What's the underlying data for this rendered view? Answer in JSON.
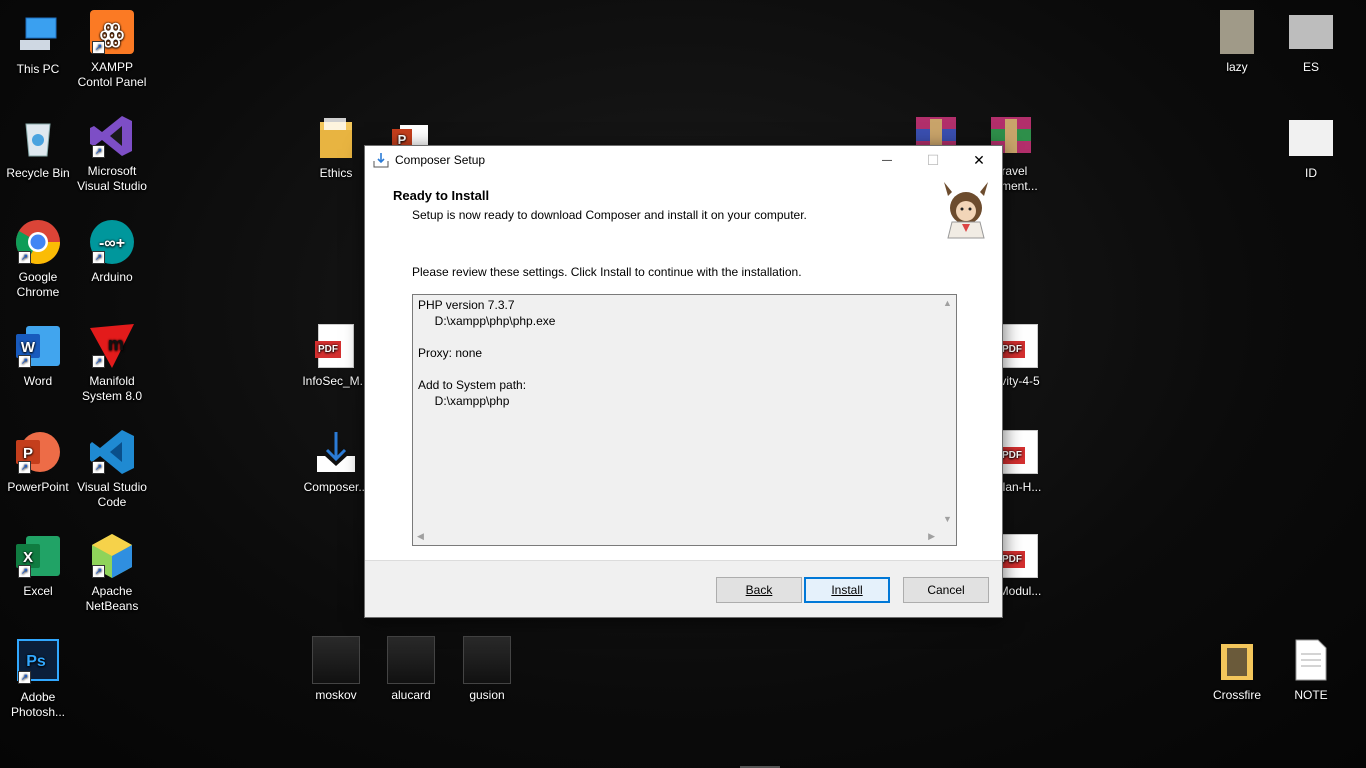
{
  "desktop": {
    "icons_left": [
      {
        "label": "This PC",
        "icon": "computer-icon"
      },
      {
        "label": "XAMPP\nContol Panel",
        "icon": "xampp-icon"
      },
      {
        "label": "Recycle Bin",
        "icon": "recycle-bin-icon"
      },
      {
        "label": "Microsoft\nVisual Studio",
        "icon": "visual-studio-icon"
      },
      {
        "label": "Google\nChrome",
        "icon": "chrome-icon"
      },
      {
        "label": "Arduino",
        "icon": "arduino-icon"
      },
      {
        "label": "Word",
        "icon": "word-icon"
      },
      {
        "label": "Manifold\nSystem 8.0",
        "icon": "manifold-icon"
      },
      {
        "label": "PowerPoint",
        "icon": "powerpoint-icon"
      },
      {
        "label": "Visual Studio\nCode",
        "icon": "vscode-icon"
      },
      {
        "label": "Excel",
        "icon": "excel-icon"
      },
      {
        "label": "Apache\nNetBeans",
        "icon": "netbeans-icon"
      },
      {
        "label": "Adobe\nPhotosh...",
        "icon": "photoshop-icon"
      }
    ],
    "icons_middle": [
      {
        "label": "Ethics"
      },
      {
        "label": "InfoSec_M..."
      },
      {
        "label": "Composer..."
      },
      {
        "label": "moskov"
      },
      {
        "label": "alucard"
      },
      {
        "label": "gusion"
      }
    ],
    "icons_right": [
      {
        "label": "lazy"
      },
      {
        "label": "ES"
      },
      {
        "label": "ID"
      },
      {
        "label": "Crossfire"
      },
      {
        "label": "NOTE"
      },
      {
        "label": "aravel\nmament..."
      },
      {
        "label": "vity-4-5"
      },
      {
        "label": "rlan-H..."
      },
      {
        "label": "Modul..."
      }
    ]
  },
  "window": {
    "title": "Composer Setup",
    "min_glyph": "—",
    "max_glyph": "☐",
    "close_glyph": "✕",
    "heading": "Ready to Install",
    "subheading": "Setup is now ready to download Composer and install it on your computer.",
    "review_text": "Please review these settings. Click Install to continue with the installation.",
    "memo_lines": [
      "PHP version 7.3.7",
      "     D:\\xampp\\php\\php.exe",
      "",
      "Proxy: none",
      "",
      "Add to System path:",
      "     D:\\xampp\\php"
    ],
    "buttons": {
      "back": "Back",
      "install": "Install",
      "cancel": "Cancel"
    }
  }
}
